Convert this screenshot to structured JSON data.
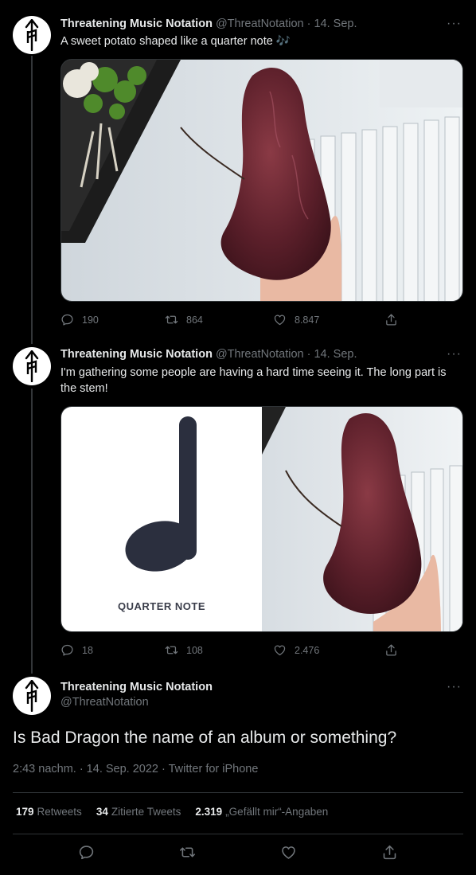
{
  "tweets": [
    {
      "name": "Threatening Music Notation",
      "handle": "@ThreatNotation",
      "date": "· 14. Sep.",
      "text": "A sweet potato shaped like a quarter note 🎶",
      "replies": "190",
      "retweets": "864",
      "likes": "8.847"
    },
    {
      "name": "Threatening Music Notation",
      "handle": "@ThreatNotation",
      "date": "· 14. Sep.",
      "text": "I'm gathering some people are having a hard time seeing it. The long part is the stem!",
      "media_caption": "QUARTER NOTE",
      "replies": "18",
      "retweets": "108",
      "likes": "2.476"
    }
  ],
  "main_tweet": {
    "name": "Threatening Music Notation",
    "handle": "@ThreatNotation",
    "text": "Is Bad Dragon the name of an album or something?",
    "meta": "2:43 nachm. · 14. Sep. 2022 · Twitter for iPhone",
    "retweets_count": "179",
    "retweets_label": "Retweets",
    "quotes_count": "34",
    "quotes_label": "Zitierte Tweets",
    "likes_count": "2.319",
    "likes_label": "„Gefällt mir“-Angaben"
  },
  "more_label": "···",
  "colors": {
    "background": "#000000",
    "text": "#e7e9ea",
    "muted": "#71767b",
    "divider": "#2f3336"
  }
}
